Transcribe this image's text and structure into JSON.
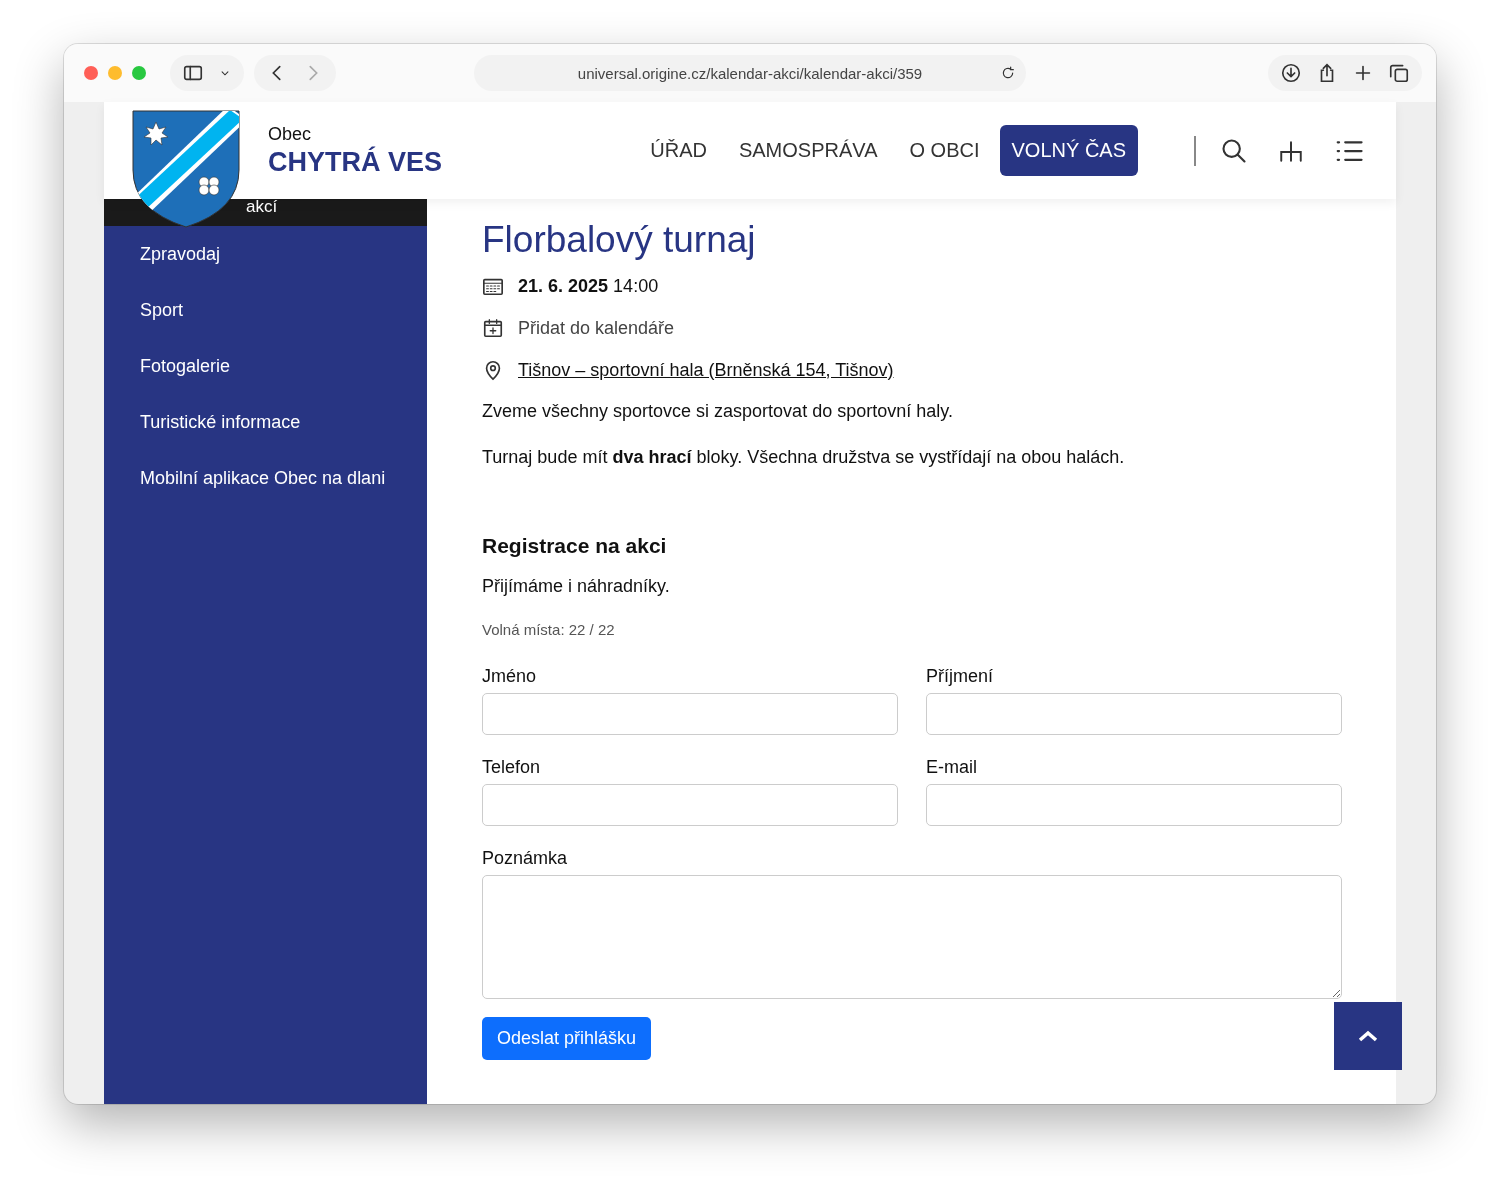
{
  "browser": {
    "url": "universal.origine.cz/kalendar-akci/kalendar-akci/359"
  },
  "site": {
    "label": "Obec",
    "name": "CHYTRÁ VES"
  },
  "nav": [
    {
      "label": "ÚŘAD",
      "selected": false
    },
    {
      "label": "SAMOSPRÁVA",
      "selected": false
    },
    {
      "label": "O OBCI",
      "selected": false
    },
    {
      "label": "VOLNÝ ČAS",
      "selected": true
    }
  ],
  "sidebar": {
    "items": [
      {
        "label": "akcí",
        "selected": true
      },
      {
        "label": "Zpravodaj",
        "selected": false
      },
      {
        "label": "Sport",
        "selected": false
      },
      {
        "label": "Fotogalerie",
        "selected": false
      },
      {
        "label": "Turistické informace",
        "selected": false
      },
      {
        "label": "Mobilní aplikace Obec na dlani",
        "selected": false
      }
    ]
  },
  "event": {
    "title": "Florbalový turnaj",
    "date": "21. 6. 2025",
    "time": "14:00",
    "add_to_calendar": "Přidat do kalendáře",
    "location": "Tišnov – sportovní hala (Brněnská 154, Tišnov)",
    "paragraphs": [
      "Zveme všechny sportovce si zasportovat do sportovní haly.",
      "Turnaj bude mít **dva hrací** bloky. Všechna družstva se vystřídají na obou halách."
    ]
  },
  "registration": {
    "heading": "Registrace na akci",
    "note": "Přijímáme i náhradníky.",
    "capacity": "Volná místa: 22 / 22",
    "fields": [
      {
        "label": "Jméno",
        "kind": "input"
      },
      {
        "label": "Příjmení",
        "kind": "input"
      },
      {
        "label": "Telefon",
        "kind": "input"
      },
      {
        "label": "E-mail",
        "kind": "input"
      },
      {
        "label": "Poznámka",
        "kind": "textarea"
      }
    ],
    "submit": "Odeslat přihlášku"
  }
}
